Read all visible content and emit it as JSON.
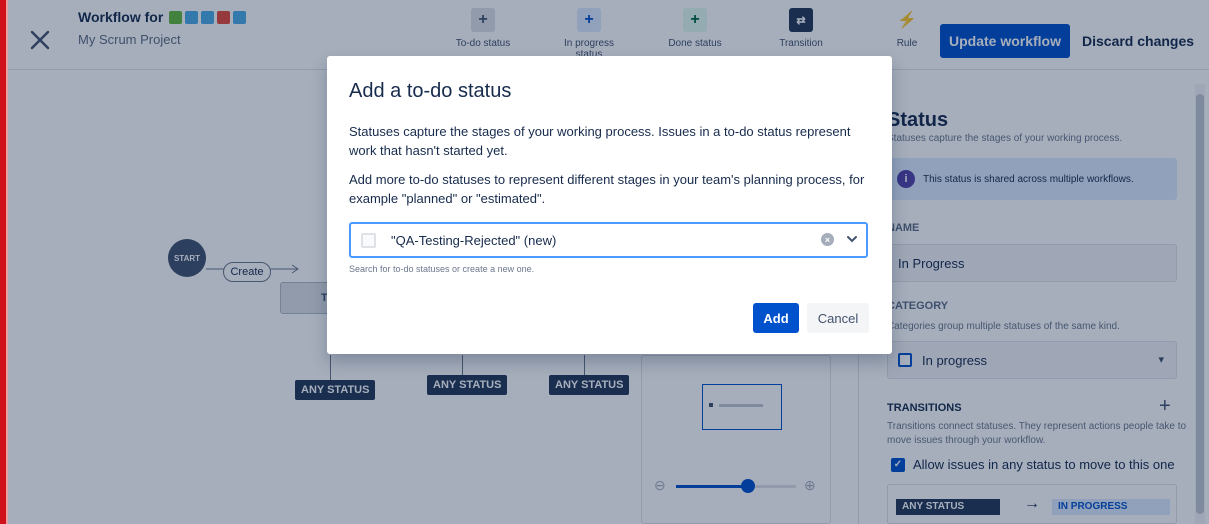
{
  "colors": {
    "brand_red": "#d0111b",
    "primary": "#0052cc",
    "focus": "#4c9aff",
    "overlay": "rgba(9, 30, 66, 0.36)"
  },
  "header": {
    "title": "Workflow for",
    "issue_type_icons": [
      "story-icon",
      "subtask-icon",
      "task-icon",
      "bug-icon",
      "epic-icon"
    ],
    "project": "My Scrum Project",
    "toolbar": [
      {
        "label": "To-do status",
        "icon": "plus-icon"
      },
      {
        "label": "In progress status",
        "icon": "plus-icon"
      },
      {
        "label": "Done status",
        "icon": "plus-icon"
      },
      {
        "label": "Transition",
        "icon": "transition-icon"
      },
      {
        "label": "Rule",
        "icon": "lightning-icon"
      }
    ],
    "update_label": "Update workflow",
    "discard_label": "Discard changes"
  },
  "canvas": {
    "start_label": "START",
    "create_label": "Create",
    "todo_label": "TO",
    "any_status_label": "ANY STATUS",
    "minimap_zoom_level": 0.6
  },
  "panel": {
    "title": "Status",
    "description": "Statuses capture the stages of your working process.",
    "shared_notice": "This status is shared across multiple workflows.",
    "name_label": "NAME",
    "name_value": "In Progress",
    "category_label": "CATEGORY",
    "category_description": "Categories group multiple statuses of the same kind.",
    "category_value": "In progress",
    "transitions_label": "TRANSITIONS",
    "transitions_description": "Transitions connect statuses. They represent actions people take to move issues through your workflow.",
    "allow_any_label": "Allow issues in any status to move to this one",
    "transition_from": "ANY STATUS",
    "transition_to": "IN PROGRESS"
  },
  "modal": {
    "title": "Add a to-do status",
    "paragraph1": "Statuses capture the stages of your working process. Issues in a to-do status represent work that hasn't started yet.",
    "paragraph2": "Add more to-do statuses to represent different stages in your team's planning process, for example \"planned\" or \"estimated\".",
    "select_value": "\"QA-Testing-Rejected\" (new)",
    "helper_text": "Search for to-do statuses or create a new one.",
    "add_label": "Add",
    "cancel_label": "Cancel"
  }
}
